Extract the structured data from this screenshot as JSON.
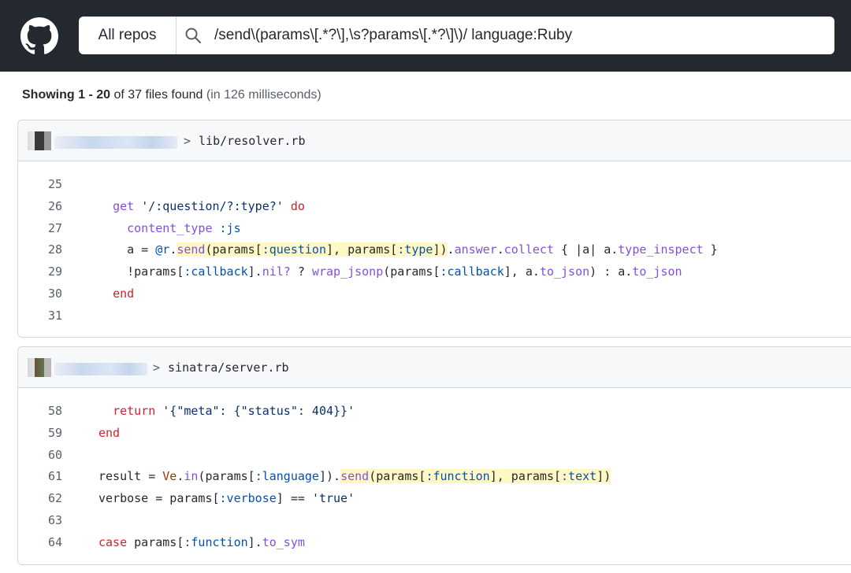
{
  "header": {
    "scope_label": "All repos",
    "query": "/send\\(params\\[.*?\\],\\s?params\\[.*?\\]\\)/ language:Ruby"
  },
  "summary": {
    "showing_label": "Showing 1 - 20",
    "of_text": " of 37 files found",
    "timing_text": " (in 126 milliseconds)"
  },
  "results": [
    {
      "path": "lib/resolver.rb",
      "lines": [
        {
          "no": "25"
        },
        {
          "no": "26"
        },
        {
          "no": "27"
        },
        {
          "no": "28"
        },
        {
          "no": "29"
        },
        {
          "no": "30"
        },
        {
          "no": "31"
        }
      ]
    },
    {
      "path": "sinatra/server.rb",
      "lines": [
        {
          "no": "58"
        },
        {
          "no": "59"
        },
        {
          "no": "60"
        },
        {
          "no": "61"
        },
        {
          "no": "62"
        },
        {
          "no": "63"
        },
        {
          "no": "64"
        }
      ]
    }
  ],
  "colors": {
    "topbar": "#24292f",
    "match_highlight": "#fff8c5",
    "keyword": "#cf222e",
    "string": "#0a3069"
  }
}
